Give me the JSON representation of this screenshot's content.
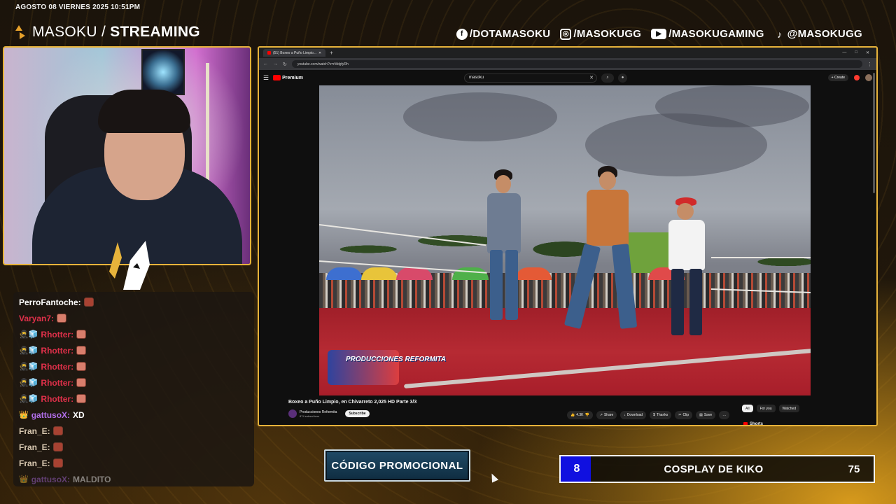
{
  "overlay": {
    "date": "AGOSTO 08 VIERNES 2025 10:51PM",
    "brand_light": "MASOKU /",
    "brand_bold": "STREAMING",
    "accent": "#e7b33b",
    "socials": [
      {
        "icon": "facebook-icon",
        "handle": "/DOTAMASOKU"
      },
      {
        "icon": "instagram-icon",
        "handle": "/MASOKUGG"
      },
      {
        "icon": "youtube-icon",
        "handle": "/MASOKUGAMING"
      },
      {
        "icon": "tiktok-icon",
        "handle": "@MASOKUGG"
      }
    ]
  },
  "chat": {
    "messages": [
      {
        "user": "PerroFantoche:",
        "color": "#ffffff",
        "text": ""
      },
      {
        "user": "Varyan7:",
        "color": "#e0304a",
        "text": ""
      },
      {
        "user": "Rhotter:",
        "color": "#e0304a",
        "text": ""
      },
      {
        "user": "Rhotter:",
        "color": "#e0304a",
        "text": ""
      },
      {
        "user": "Rhotter:",
        "color": "#e0304a",
        "text": ""
      },
      {
        "user": "Rhotter:",
        "color": "#e0304a",
        "text": ""
      },
      {
        "user": "Rhotter:",
        "color": "#e0304a",
        "text": ""
      },
      {
        "user": "gattusoX:",
        "color": "#b06ee8",
        "text": "XD"
      },
      {
        "user": "Fran_E:",
        "color": "#d8c8b0",
        "text": ""
      },
      {
        "user": "Fran_E:",
        "color": "#d8c8b0",
        "text": ""
      },
      {
        "user": "Fran_E:",
        "color": "#d8c8b0",
        "text": ""
      },
      {
        "user": "gattusoX:",
        "color": "#b06ee8",
        "text": "MALDITO"
      }
    ]
  },
  "browser": {
    "tab_title": "(51) Boxeo a Puño Limpio...",
    "url": "youtube.com/watch?v=rMdgfyRh",
    "yt_logo": "Premium",
    "search_value": "masoku",
    "create_label": "+ Create",
    "video_watermark": "PRODUCCIONES REFORMITA",
    "video_title": "Boxeo a Puño Limpio, en Chivarreto 2,025 HD Parte 3/3",
    "channel_name": "Producciones Reformita",
    "channel_subs": "874 subscribers",
    "subscribe_label": "Subscribe",
    "actions": [
      {
        "icon": "like-icon",
        "label": "4.3K"
      },
      {
        "icon": "share-icon",
        "label": "Share"
      },
      {
        "icon": "download-icon",
        "label": "Download"
      },
      {
        "icon": "thanks-icon",
        "label": "Thanks"
      },
      {
        "icon": "clip-icon",
        "label": "Clip"
      },
      {
        "icon": "save-icon",
        "label": "Save"
      }
    ],
    "chips": [
      "All",
      "For you",
      "Watched"
    ],
    "shorts_label": "Shorts"
  },
  "promo": {
    "label": "CÓDIGO PROMOCIONAL"
  },
  "poll": {
    "left_value": "8",
    "label": "COSPLAY DE KIKO",
    "right_value": "75",
    "left_color": "#1010e0",
    "left_fraction": 0.096
  }
}
